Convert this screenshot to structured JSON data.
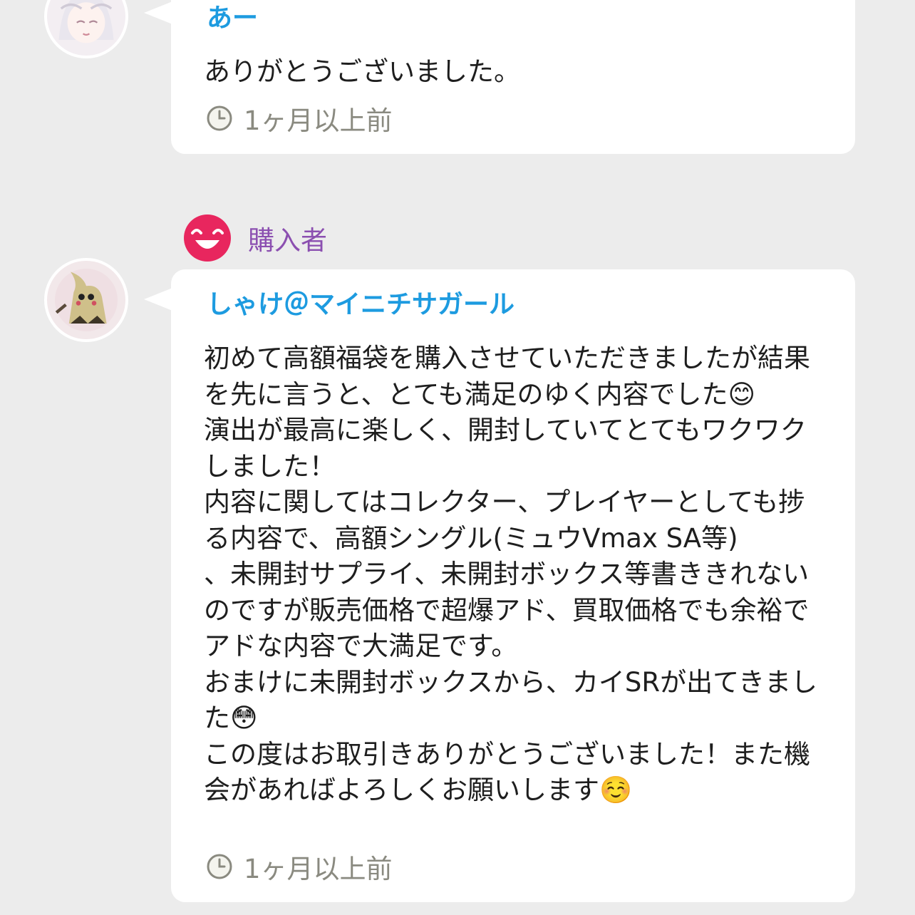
{
  "comments": [
    {
      "author": "あー",
      "avatar_icon": "avatar-icon",
      "text": "ありがとうございました。",
      "time": "1ヶ月以上前"
    },
    {
      "badge": {
        "icon": "smile-face-icon",
        "label": "購入者",
        "color": "#e8265e"
      },
      "author": "しゃけ＠マイニチサガール",
      "avatar_icon": "avatar-icon",
      "text": "初めて高額福袋を購入させていただきましたが結果を先に言うと、とても満足のゆく内容でした😊\n演出が最高に楽しく、開封していてとてもワクワクしました！\n内容に関してはコレクター、プレイヤーとしても捗る内容で、高額シングル(ミュウVmax SA等)\n、未開封サプライ、未開封ボックス等書ききれないのですが販売価格で超爆アド、買取価格でも余裕でアドな内容で大満足です。\nおまけに未開封ボックスから、カイSRが出てきました😳\nこの度はお取引きありがとうございました！また機会があればよろしくお願いします☺️",
      "time": "1ヶ月以上前"
    }
  ],
  "colors": {
    "background": "#ececec",
    "author_name": "#1d9be0",
    "buyer_label": "#8b4fb0",
    "timestamp": "#8a8a80"
  }
}
